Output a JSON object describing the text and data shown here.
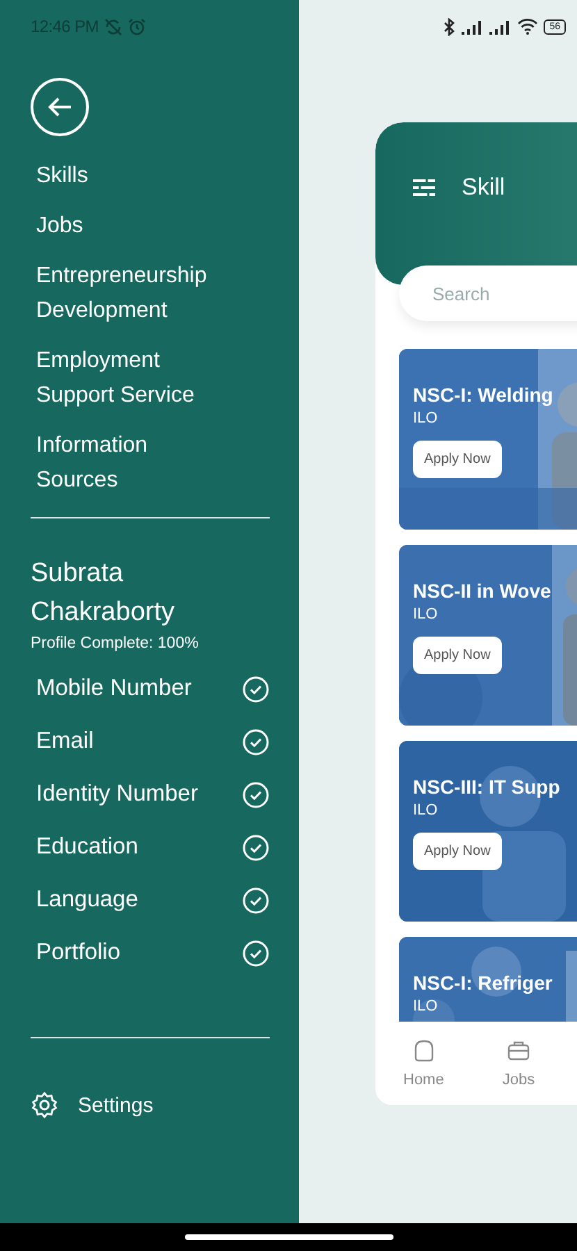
{
  "status_bar": {
    "time": "12:46 PM",
    "battery": "56"
  },
  "drawer": {
    "menu": [
      {
        "label": "Skills"
      },
      {
        "label": "Jobs"
      },
      {
        "label": "Entrepreneurship Development"
      },
      {
        "label": "Employment Support Service"
      },
      {
        "label": "Information Sources"
      }
    ],
    "profile": {
      "name": "Subrata Chakraborty",
      "completion": "Profile Complete: 100%",
      "items": [
        {
          "label": "Mobile Number",
          "checked": true
        },
        {
          "label": "Email",
          "checked": true
        },
        {
          "label": "Identity Number",
          "checked": true
        },
        {
          "label": "Education",
          "checked": true
        },
        {
          "label": "Language",
          "checked": true
        },
        {
          "label": "Portfolio",
          "checked": true
        }
      ]
    },
    "settings": "Settings"
  },
  "main": {
    "title": "Skill",
    "search": {
      "placeholder": "Search"
    },
    "courses": [
      {
        "title": "NSC-I: Welding",
        "provider": "ILO",
        "button": "Apply Now"
      },
      {
        "title": "NSC-II in Wove",
        "provider": "ILO",
        "button": "Apply Now"
      },
      {
        "title": "NSC-III: IT Supp",
        "provider": "ILO",
        "button": "Apply Now"
      },
      {
        "title": "NSC-I: Refriger",
        "provider": "ILO"
      }
    ],
    "bottom_nav": [
      {
        "label": "Home",
        "kind": "home"
      },
      {
        "label": "Jobs",
        "kind": "jobs"
      }
    ]
  }
}
